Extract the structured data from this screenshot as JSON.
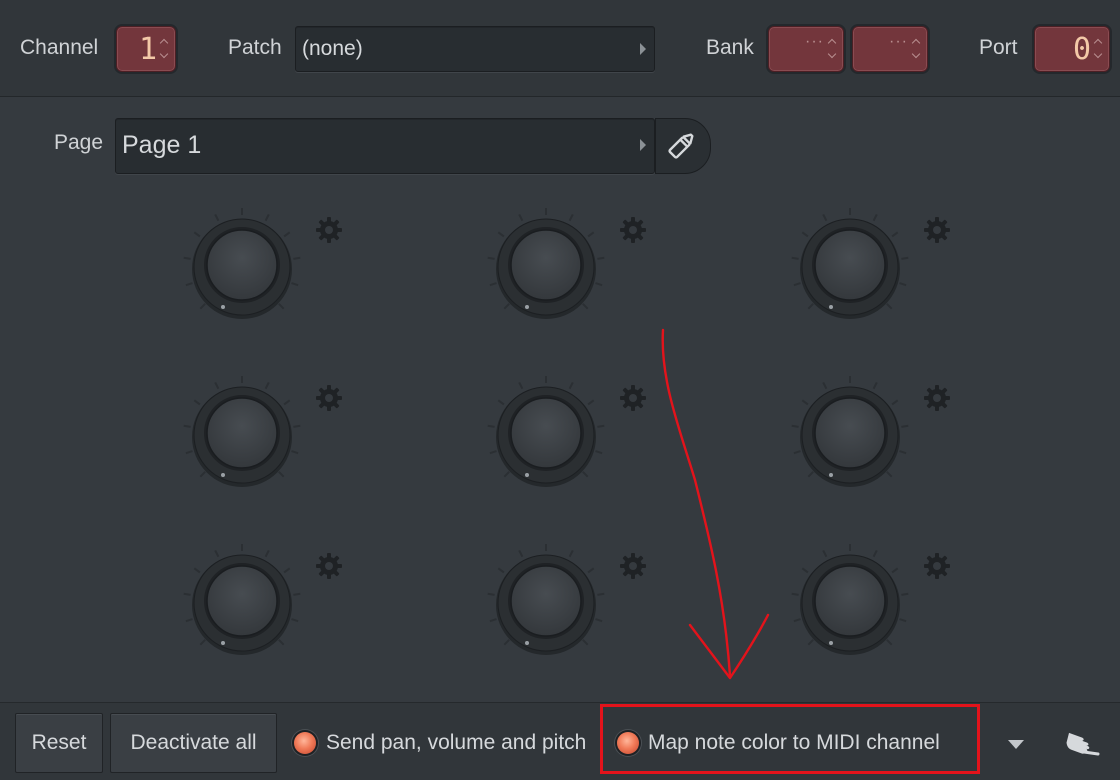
{
  "toolbar": {
    "channel_label": "Channel",
    "channel_value": "1",
    "patch_label": "Patch",
    "patch_value": "(none)",
    "bank_label": "Bank",
    "bank_value_1": "···",
    "bank_value_2": "···",
    "port_label": "Port",
    "port_value": "0"
  },
  "page": {
    "label": "Page",
    "value": "Page 1",
    "edit_icon": "pencil-icon"
  },
  "knobs": {
    "count": 9,
    "icon": "gear-icon"
  },
  "bottom": {
    "reset_label": "Reset",
    "deactivate_label": "Deactivate all",
    "option_send_label": "Send pan, volume and pitch",
    "option_map_label": "Map note color to MIDI channel",
    "dropdown_icon": "caret-down-icon",
    "hand_icon": "hand-pointer-icon"
  },
  "annotation": {
    "highlight_color": "#e3131b",
    "arrow_color": "#e3131b"
  },
  "colors": {
    "background": "#353a3f",
    "accent_red": "#73363c",
    "radio": "#f07a58"
  }
}
